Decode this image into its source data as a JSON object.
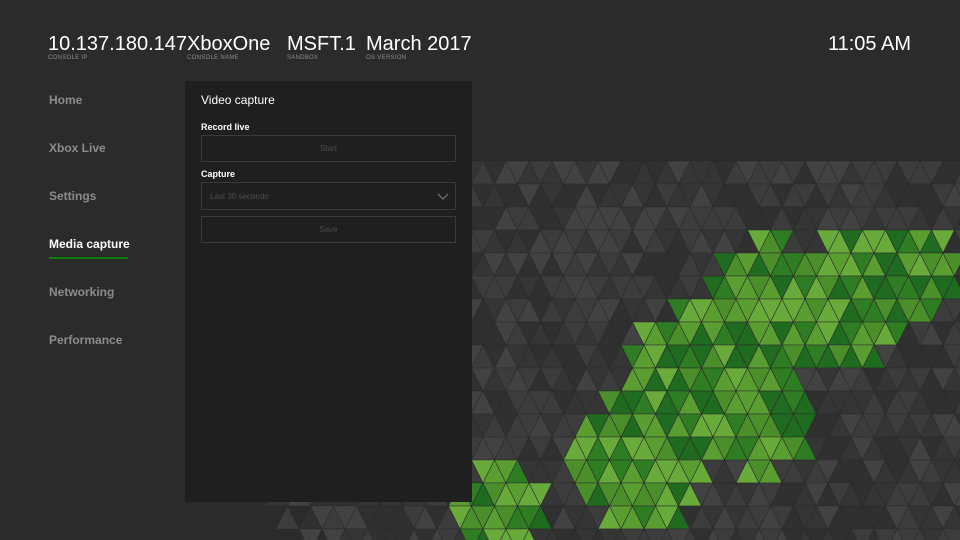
{
  "header": {
    "items": [
      {
        "value": "10.137.180.147",
        "label": "CONSOLE IP"
      },
      {
        "value": "XboxOne",
        "label": "CONSOLE NAME"
      },
      {
        "value": "MSFT.1",
        "label": "SANDBOX"
      },
      {
        "value": "March 2017",
        "label": "OS VERSION"
      }
    ],
    "time": "11:05 AM"
  },
  "nav": {
    "items": [
      {
        "label": "Home"
      },
      {
        "label": "Xbox Live"
      },
      {
        "label": "Settings"
      },
      {
        "label": "Media capture",
        "active": true
      },
      {
        "label": "Networking"
      },
      {
        "label": "Performance"
      }
    ]
  },
  "panel": {
    "title": "Video capture",
    "record_live_label": "Record live",
    "start_button": "Start",
    "capture_label": "Capture",
    "capture_selected": "Last 30 seconds",
    "save_button": "Save"
  },
  "colors": {
    "background": "#2b2b2b",
    "panel": "#1f1f1f",
    "accent": "#107c10",
    "pattern_grey": "#3c3c3c",
    "pattern_green_light": "#5a9e32",
    "pattern_green_dark": "#1f6b1f"
  },
  "icons": [
    "chevron-down-icon"
  ]
}
